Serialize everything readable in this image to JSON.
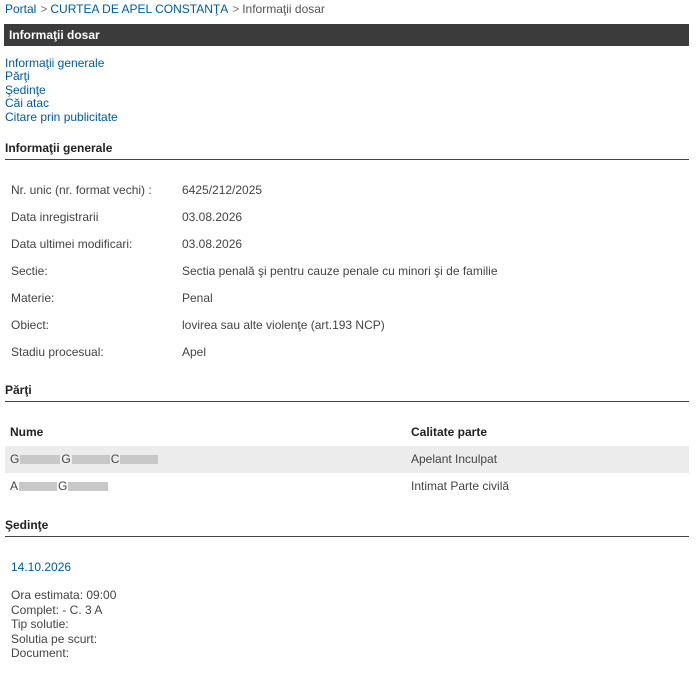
{
  "breadcrumb": {
    "portal": "Portal",
    "court": "CURTEA DE APEL CONSTANŢA",
    "current": "Informaţii dosar",
    "separator": ">"
  },
  "page_title": "Informaţii dosar",
  "quick_nav": [
    "Informaţii generale",
    "Părţi",
    "Şedinţe",
    "Căi atac",
    "Citare prin publicitate"
  ],
  "general": {
    "heading": "Informaţii generale",
    "rows": [
      {
        "label": "Nr. unic (nr. format vechi) :",
        "value": "6425/212/2025"
      },
      {
        "label": "Data inregistrarii",
        "value": "03.08.2026"
      },
      {
        "label": "Data ultimei modificari:",
        "value": "03.08.2026"
      },
      {
        "label": "Sectie:",
        "value": "Sectia penală şi pentru cauze penale cu minori şi de familie"
      },
      {
        "label": "Materie:",
        "value": "Penal"
      },
      {
        "label": "Obiect:",
        "value": "lovirea sau alte violenţe (art.193 NCP)"
      },
      {
        "label": "Stadiu procesual:",
        "value": "Apel"
      }
    ]
  },
  "parties": {
    "heading": "Părţi",
    "col_name": "Nume",
    "col_role": "Calitate parte",
    "rows": [
      {
        "initials": [
          "G",
          "G",
          "C"
        ],
        "role": "Apelant Inculpat"
      },
      {
        "initials": [
          "A",
          "G"
        ],
        "role": "Intimat Parte civilă"
      }
    ]
  },
  "hearings": {
    "heading": "Şedinţe",
    "date": "14.10.2026",
    "lines": [
      "Ora estimata: 09:00",
      "Complet: - C. 3 A",
      "Tip solutie:",
      "Solutia pe scurt:",
      "Document:"
    ]
  }
}
